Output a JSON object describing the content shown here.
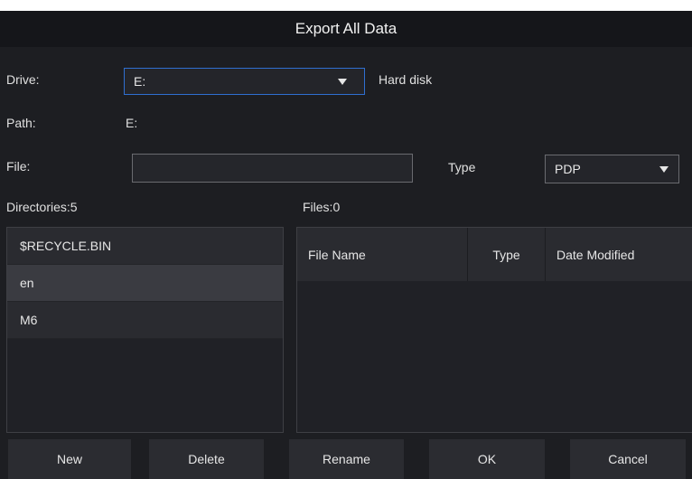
{
  "dialog": {
    "title": "Export All Data"
  },
  "drive": {
    "label": "Drive:",
    "value": "E:",
    "description": "Hard disk"
  },
  "path": {
    "label": "Path:",
    "value": "E:"
  },
  "file": {
    "label": "File:",
    "value": "",
    "type_label": "Type",
    "type_value": "PDP"
  },
  "directories": {
    "label": "Directories:5",
    "items": [
      "$RECYCLE.BIN",
      "en",
      "M6"
    ],
    "selected_index": 1
  },
  "files": {
    "label": "Files:0",
    "columns": [
      "File Name",
      "Type",
      "Date Modified"
    ],
    "rows": []
  },
  "buttons": {
    "new": "New",
    "delete": "Delete",
    "rename": "Rename",
    "ok": "OK",
    "cancel": "Cancel"
  }
}
